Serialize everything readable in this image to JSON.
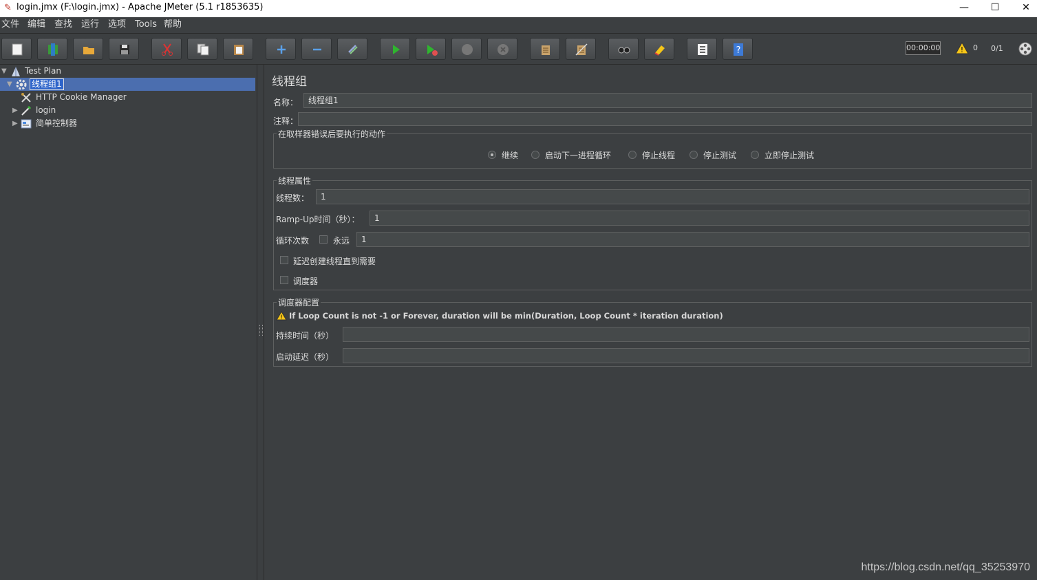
{
  "window": {
    "title": "login.jmx (F:\\login.jmx) - Apache JMeter (5.1 r1853635)",
    "min_glyph": "—",
    "max_glyph": "☐",
    "close_glyph": "✕"
  },
  "menubar": [
    "文件",
    "编辑",
    "查找",
    "运行",
    "选项",
    "Tools",
    "帮助"
  ],
  "toolbar": {
    "buttons": [
      "new-icon",
      "templates-icon",
      "open-icon",
      "save-icon",
      "cut-icon",
      "copy-icon",
      "paste-icon",
      "expand-icon",
      "collapse-icon",
      "toggle-icon",
      "start-icon",
      "start-no-pause-icon",
      "stop-icon",
      "shutdown-icon",
      "clear-icon",
      "clear-all-icon",
      "search-icon",
      "reset-search-icon",
      "function-helper-icon",
      "help-icon"
    ],
    "timer": "00:00:00",
    "warning_count": "0",
    "threads": "0/1"
  },
  "tree": {
    "items": [
      {
        "label": "Test Plan",
        "icon": "test-plan-icon"
      },
      {
        "label": "线程组1",
        "icon": "thread-group-icon"
      },
      {
        "label": "HTTP Cookie Manager",
        "icon": "cookie-manager-icon"
      },
      {
        "label": "login",
        "icon": "sampler-icon"
      },
      {
        "label": "简单控制器",
        "icon": "simple-controller-icon"
      }
    ]
  },
  "panel": {
    "title": "线程组",
    "name_label": "名称：",
    "name_value": "线程组1",
    "comment_label": "注释：",
    "comment_value": "",
    "error_group": {
      "title": "在取样器错误后要执行的动作",
      "options": [
        "继续",
        "启动下一进程循环",
        "停止线程",
        "停止测试",
        "立即停止测试"
      ],
      "selected": "继续"
    },
    "thread_props": {
      "title": "线程属性",
      "threads_label": "线程数：",
      "threads_value": "1",
      "rampup_label": "Ramp-Up时间（秒）：",
      "rampup_value": "1",
      "loop_label": "循环次数",
      "forever_label": "永远",
      "forever_checked": false,
      "loop_value": "1",
      "delay_label": "延迟创建线程直到需要",
      "delay_checked": false,
      "scheduler_label": "调度器",
      "scheduler_checked": false
    },
    "scheduler_config": {
      "title": "调度器配置",
      "warning": "If Loop Count is not -1 or Forever, duration will be min(Duration, Loop Count * iteration duration)",
      "duration_label": "持续时间（秒）",
      "duration_value": "",
      "delay_label": "启动延迟（秒）",
      "delay_value": ""
    }
  },
  "watermark": "https://blog.csdn.net/qq_35253970"
}
